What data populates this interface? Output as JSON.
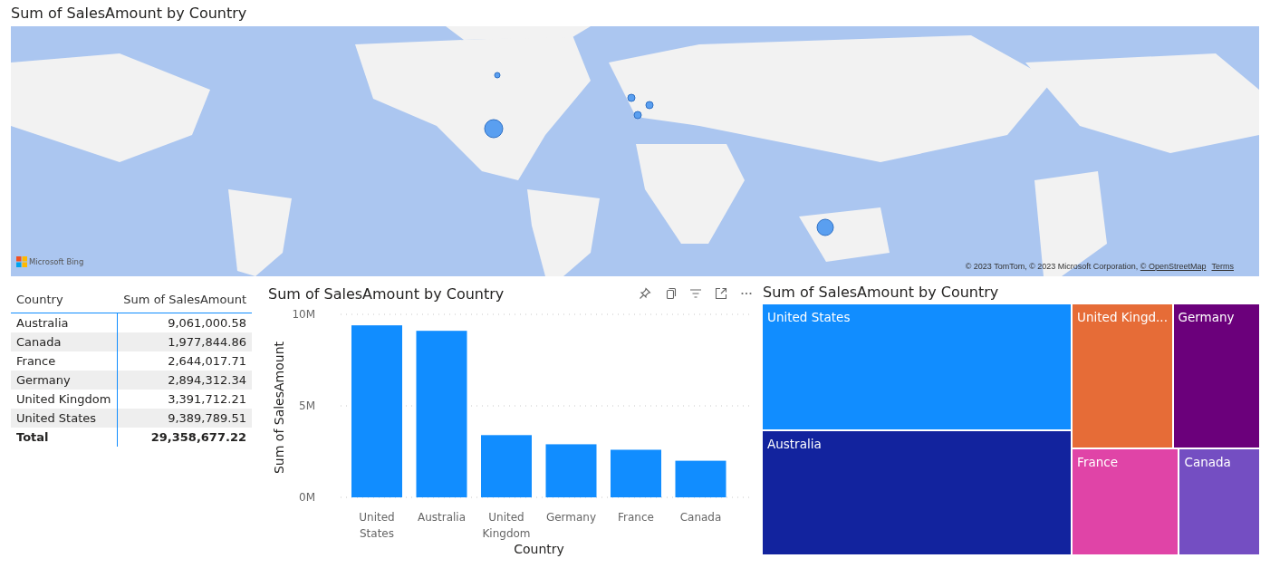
{
  "map": {
    "title": "Sum of SalesAmount by Country",
    "logo": "Microsoft Bing",
    "attribution": "© 2023 TomTom, © 2023 Microsoft Corporation, ",
    "attribution_link": "© OpenStreetMap",
    "terms_link": "Terms"
  },
  "table": {
    "columns": [
      "Country",
      "Sum of SalesAmount"
    ],
    "rows": [
      {
        "country": "Australia",
        "amount": "9,061,000.58"
      },
      {
        "country": "Canada",
        "amount": "1,977,844.86"
      },
      {
        "country": "France",
        "amount": "2,644,017.71"
      },
      {
        "country": "Germany",
        "amount": "2,894,312.34"
      },
      {
        "country": "United Kingdom",
        "amount": "3,391,712.21"
      },
      {
        "country": "United States",
        "amount": "9,389,789.51"
      }
    ],
    "total": {
      "label": "Total",
      "amount": "29,358,677.22"
    }
  },
  "bar_visual": {
    "chart_data": {
      "type": "bar",
      "title": "Sum of SalesAmount by Country",
      "xlabel": "Country",
      "ylabel": "Sum of SalesAmount",
      "categories": [
        "United States",
        "Australia",
        "United Kingdom",
        "Germany",
        "France",
        "Canada"
      ],
      "series": [
        {
          "color": "#118dff",
          "values": [
            9400000,
            9100000,
            3400000,
            2900000,
            2600000,
            2000000
          ]
        }
      ],
      "ylim": [
        0,
        10000000
      ],
      "yticks": [
        {
          "value": 0,
          "label": "0M"
        },
        {
          "value": 5000000,
          "label": "5M"
        },
        {
          "value": 10000000,
          "label": "10M"
        }
      ]
    }
  },
  "treemap": {
    "title": "Sum of SalesAmount by Country",
    "tiles": [
      {
        "label": "United States",
        "color": "#118dff"
      },
      {
        "label": "Australia",
        "color": "#12239e"
      },
      {
        "label": "United Kingd...",
        "color": "#e66c37"
      },
      {
        "label": "Germany",
        "color": "#6b007b"
      },
      {
        "label": "France",
        "color": "#e044a7"
      },
      {
        "label": "Canada",
        "color": "#744ec2"
      }
    ]
  }
}
